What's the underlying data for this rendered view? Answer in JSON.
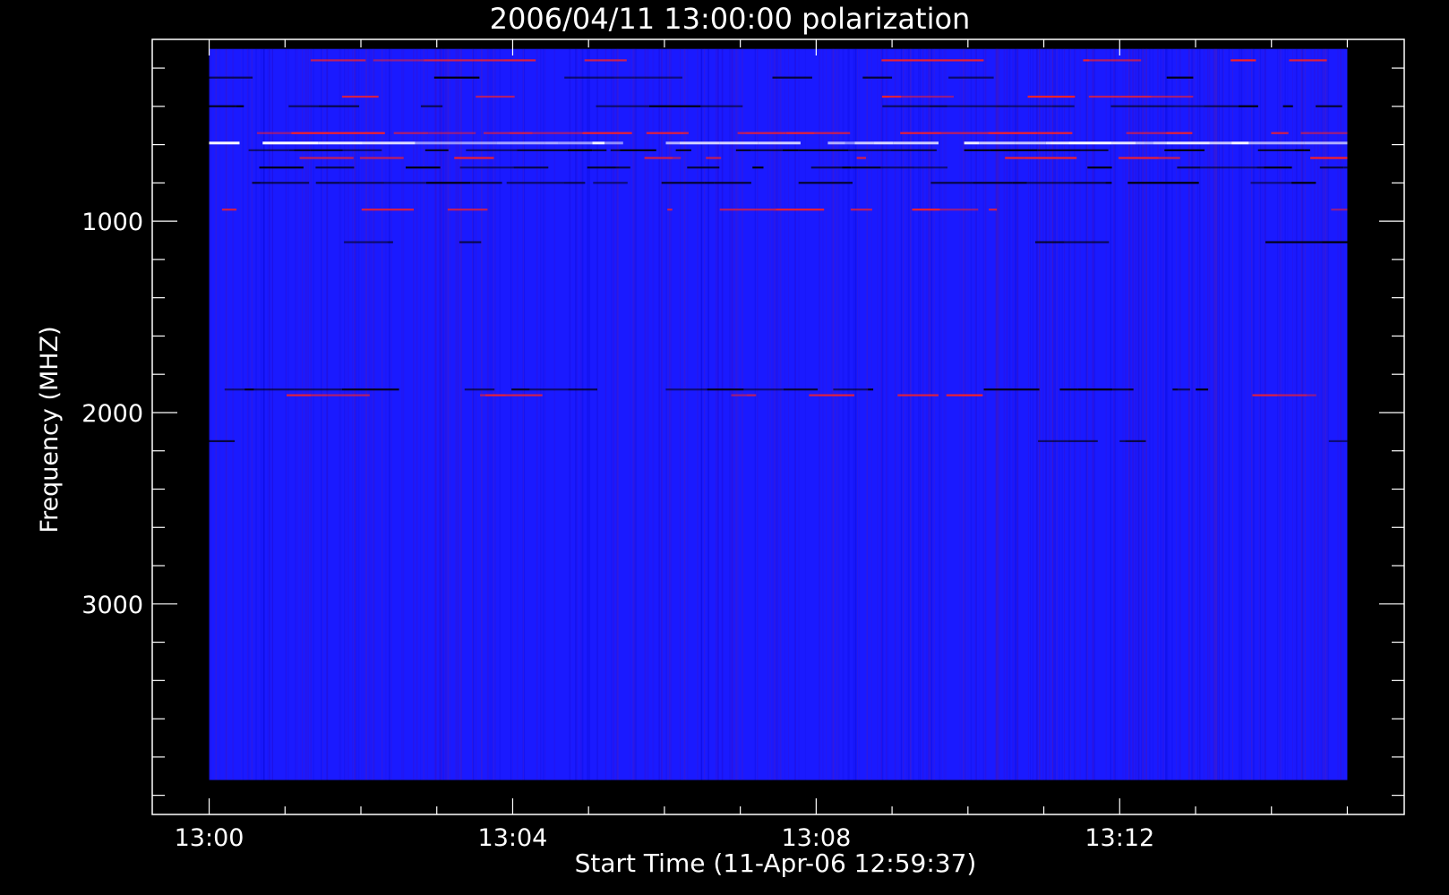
{
  "chart_data": {
    "type": "heatmap",
    "title": "2006/04/11 13:00:00 polarization",
    "xlabel": "Start Time (11-Apr-06 12:59:37)",
    "ylabel": "Frequency (MHZ)",
    "x_ticks": [
      "13:00",
      "13:04",
      "13:08",
      "13:12"
    ],
    "x_tick_values_min": [
      0,
      4,
      8,
      12
    ],
    "x_minor_step_min": 1,
    "y_ticks": [
      "1000",
      "2000",
      "3000"
    ],
    "y_tick_values": [
      1000,
      2000,
      3000
    ],
    "y_minor_step": 200,
    "xlim_min": [
      -0.75,
      15.75
    ],
    "ylim": [
      4100,
      50
    ],
    "data_xlim_min": [
      0,
      15
    ],
    "data_ylim": [
      3920,
      100
    ],
    "background_color": "#1a1aff",
    "colors": {
      "axes": "#ffffff",
      "low": "#000000",
      "mid": "#ff2020",
      "high": "#ffffff",
      "frame": "#000000"
    },
    "bands": [
      {
        "freq": 160,
        "level": "mid",
        "strength": 0.35
      },
      {
        "freq": 250,
        "level": "low",
        "strength": 0.3
      },
      {
        "freq": 350,
        "level": "mid",
        "strength": 0.25
      },
      {
        "freq": 400,
        "level": "low",
        "strength": 0.5
      },
      {
        "freq": 540,
        "level": "mid",
        "strength": 0.6
      },
      {
        "freq": 590,
        "level": "high",
        "strength": 0.85
      },
      {
        "freq": 630,
        "level": "low",
        "strength": 0.7
      },
      {
        "freq": 670,
        "level": "mid",
        "strength": 0.5
      },
      {
        "freq": 720,
        "level": "low",
        "strength": 0.5
      },
      {
        "freq": 800,
        "level": "low",
        "strength": 0.6
      },
      {
        "freq": 940,
        "level": "mid",
        "strength": 0.3
      },
      {
        "freq": 1110,
        "level": "low",
        "strength": 0.2
      },
      {
        "freq": 1880,
        "level": "low",
        "strength": 0.55
      },
      {
        "freq": 1910,
        "level": "mid",
        "strength": 0.35
      },
      {
        "freq": 2150,
        "level": "low",
        "strength": 0.12
      }
    ]
  }
}
